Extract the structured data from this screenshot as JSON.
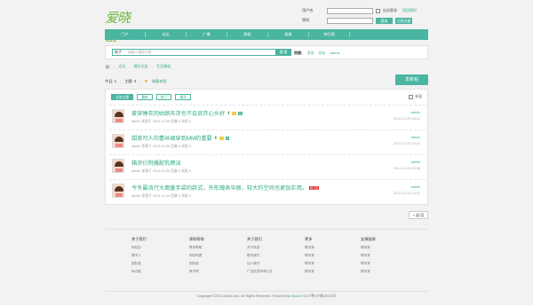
{
  "header": {
    "logo_text": "爱晓游",
    "username_label": "用户名",
    "password_label": "密码",
    "remember_label": "自动登录",
    "forgot_link": "找回密码",
    "login_button": "登录",
    "register_button": "立即注册"
  },
  "nav": {
    "items": [
      "门户",
      "论坛",
      "广播",
      "群组",
      "相册",
      "排行榜"
    ]
  },
  "search": {
    "select_value": "帖子",
    "placeholder": "请输入搜索内容",
    "button": "搜 索",
    "hot_label": "热搜:",
    "hot_words": [
      "活动",
      "交友",
      "discuz"
    ]
  },
  "breadcrumb": {
    "items": [
      "论坛",
      "聊天交友",
      "生活漫谈"
    ]
  },
  "toolbar": {
    "today_label": "今日: 1",
    "topics_label": "主题: 4",
    "favorite_label": "收藏本版",
    "post_button": "发新帖"
  },
  "filters": {
    "items": [
      "全部主题",
      "最新",
      "热门",
      "精华"
    ],
    "new_window_label": "新窗"
  },
  "threads": [
    {
      "title": "爱穿睡衣的姑娘天凉也不会放弃心头好",
      "meta": "admin 发表于 2012-12-20  回复 0  浏览 0",
      "author": "admin",
      "time": "2012-12-20 18:12",
      "badges": [
        "up",
        "img",
        "new"
      ]
    },
    {
      "title": "甜美可人的蕾丝裙穿到MM的重要",
      "meta": "admin 发表于 2012-12-20  回复 0  浏览 0",
      "author": "admin",
      "time": "2012-12-20 18:10",
      "badges": [
        "up",
        "img",
        "new"
      ]
    },
    {
      "title": "箱凉衍阴搔配乳晒淡",
      "meta": "admin 发表于 2012-12-20  回复 0  浏览 0",
      "author": "admin",
      "time": "2012-12-20 16:46",
      "badges": []
    },
    {
      "title": "今冬最流行大面量手袋的款式，外形瑰表华丽，较大的空间也更加实用。",
      "meta": "admin 发表于 2012-12-14  回复 0  浏览 0",
      "author": "admin",
      "time": "2012-12-14 14:01",
      "badges": [
        "hot"
      ],
      "hot_label": "热门话"
    }
  ],
  "pager": {
    "label": "< 返 回"
  },
  "footer": {
    "columns": [
      {
        "heading": "关于我们",
        "links": [
          "网站由",
          "基本人",
          "团队链",
          "网点链"
        ]
      },
      {
        "heading": "获取帮助",
        "links": [
          "联系帮助",
          "网站地图",
          "团队链",
          "新手帮"
        ]
      },
      {
        "heading": "关于我们",
        "links": [
          "关于晓游",
          "联系我们",
          "加入我们",
          "广告投放申请公告"
        ]
      },
      {
        "heading": "更多",
        "links": [
          "联系我",
          "联系我",
          "联系我",
          "联系我"
        ]
      },
      {
        "heading": "友情链接",
        "links": [
          "联系我",
          "联系我",
          "联系我",
          "联系我"
        ]
      }
    ],
    "copyright": "Copyright ©2012 aixiuli.com. All Rights Reserved. Powered by",
    "copyright_link": "Discuz!",
    "copyright_tail": "X2.5 粤ICP备10015号"
  }
}
